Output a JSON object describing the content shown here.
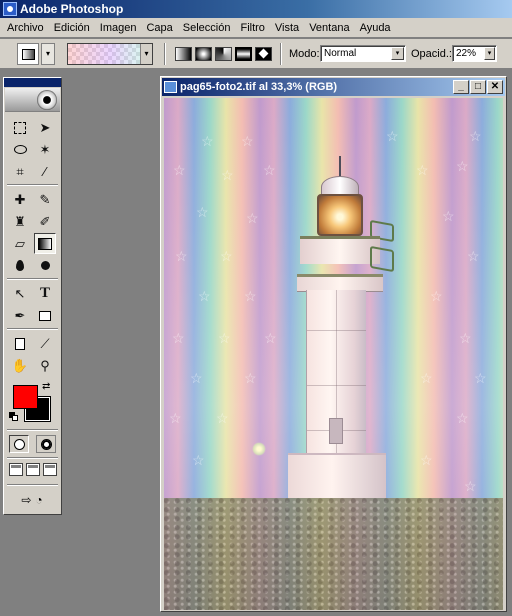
{
  "app": {
    "title": "Adobe Photoshop"
  },
  "menu": {
    "items": [
      "Archivo",
      "Edición",
      "Imagen",
      "Capa",
      "Selección",
      "Filtro",
      "Vista",
      "Ventana",
      "Ayuda"
    ]
  },
  "options_bar": {
    "mode_label": "Modo:",
    "mode_value": "Normal",
    "opacity_label": "Opacid.:",
    "opacity_value": "22%",
    "gradient_types": [
      "linear",
      "radial",
      "angle",
      "reflected",
      "diamond"
    ],
    "dropdown_arrow": "▾"
  },
  "toolbox": {
    "foreground_color": "#ff0000",
    "background_color": "#000000",
    "active_tool": "gradient-tool"
  },
  "document": {
    "title": "pag65-foto2.tif al 33,3% (RGB)",
    "minimize_glyph": "_",
    "maximize_glyph": "□",
    "close_glyph": "✕"
  },
  "colors": {
    "title_bar": "#0a246a",
    "chrome": "#d4d0c8",
    "workspace": "#808080"
  }
}
